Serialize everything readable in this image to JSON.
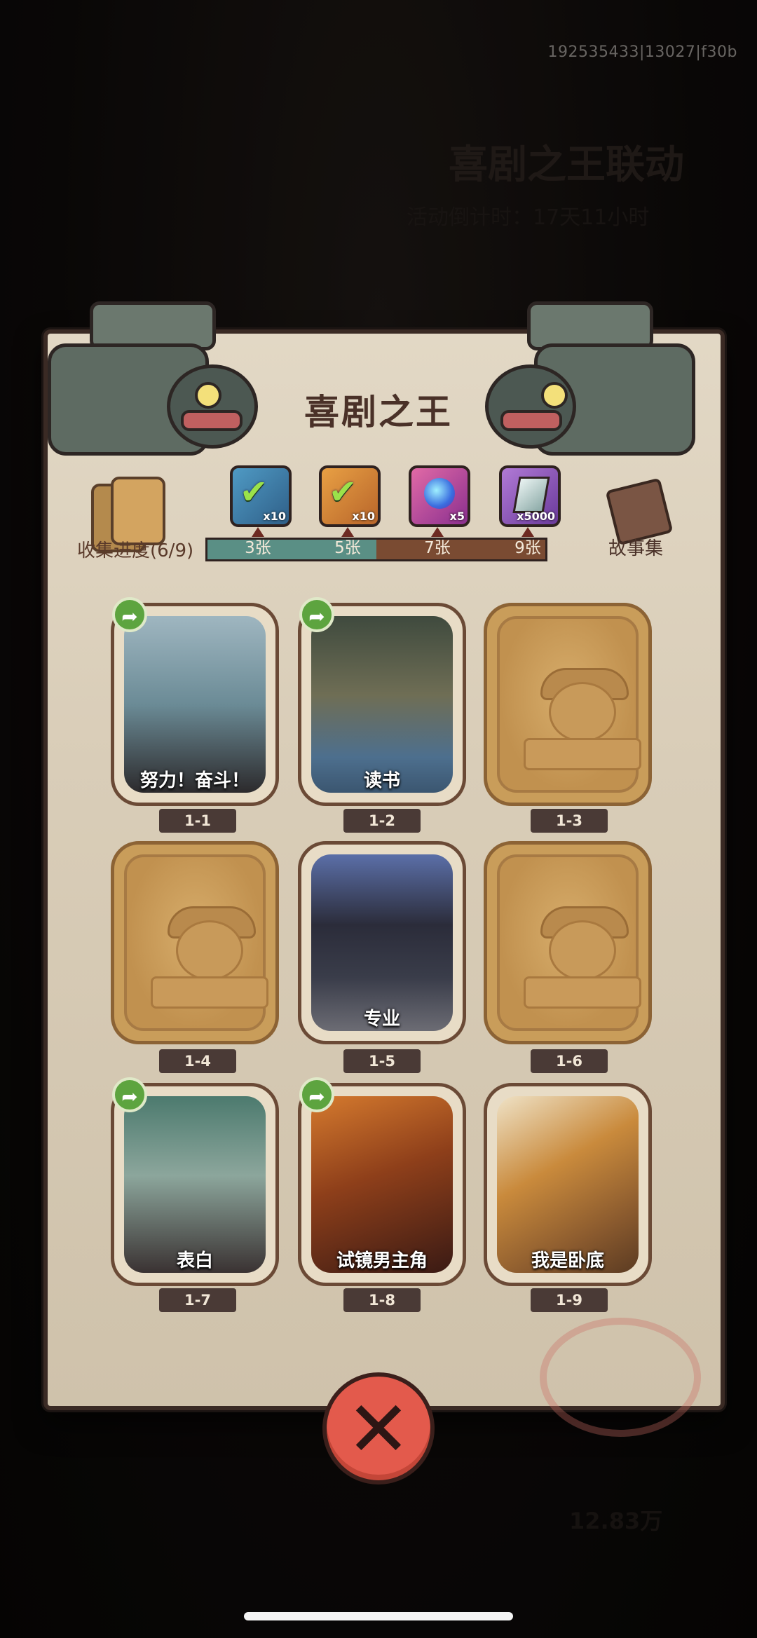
{
  "background": {
    "uid": "192535433|13027|f30b",
    "event_title": "喜剧之王联动",
    "countdown": "活动倒计时：17天11小时",
    "currency_amount": "12.83万"
  },
  "modal": {
    "title": "喜剧之王",
    "collect_progress_label": "收集进度(6/9)",
    "story_label": "故事集",
    "progress": {
      "collected": 6,
      "total": 9
    },
    "rewards": [
      {
        "icon": "gold-ticket-icon",
        "qty": "x10",
        "claimed": true
      },
      {
        "icon": "gold-ticket-icon",
        "qty": "x10",
        "claimed": true
      },
      {
        "icon": "purple-orb-icon",
        "qty": "x5",
        "claimed": false
      },
      {
        "icon": "crystal-icon",
        "qty": "x5000",
        "claimed": false
      }
    ],
    "milestones": [
      "3张",
      "5张",
      "7张",
      "9张"
    ],
    "cards": [
      {
        "id": "1-1",
        "name": "努力！奋斗！",
        "unlocked": true,
        "shareable": true
      },
      {
        "id": "1-2",
        "name": "读书",
        "unlocked": true,
        "shareable": true
      },
      {
        "id": "1-3",
        "name": "",
        "unlocked": false,
        "shareable": false
      },
      {
        "id": "1-4",
        "name": "",
        "unlocked": false,
        "shareable": false
      },
      {
        "id": "1-5",
        "name": "专业",
        "unlocked": true,
        "shareable": false
      },
      {
        "id": "1-6",
        "name": "",
        "unlocked": false,
        "shareable": false
      },
      {
        "id": "1-7",
        "name": "表白",
        "unlocked": true,
        "shareable": true
      },
      {
        "id": "1-8",
        "name": "试镜男主角",
        "unlocked": true,
        "shareable": true
      },
      {
        "id": "1-9",
        "name": "我是卧底",
        "unlocked": true,
        "shareable": false
      }
    ]
  },
  "colors": {
    "panel": "#d9cdb8",
    "title": "#4a3128",
    "close_button": "#e35a4c",
    "share_badge": "#5da43f",
    "progress_fill": "#5a8f85"
  }
}
